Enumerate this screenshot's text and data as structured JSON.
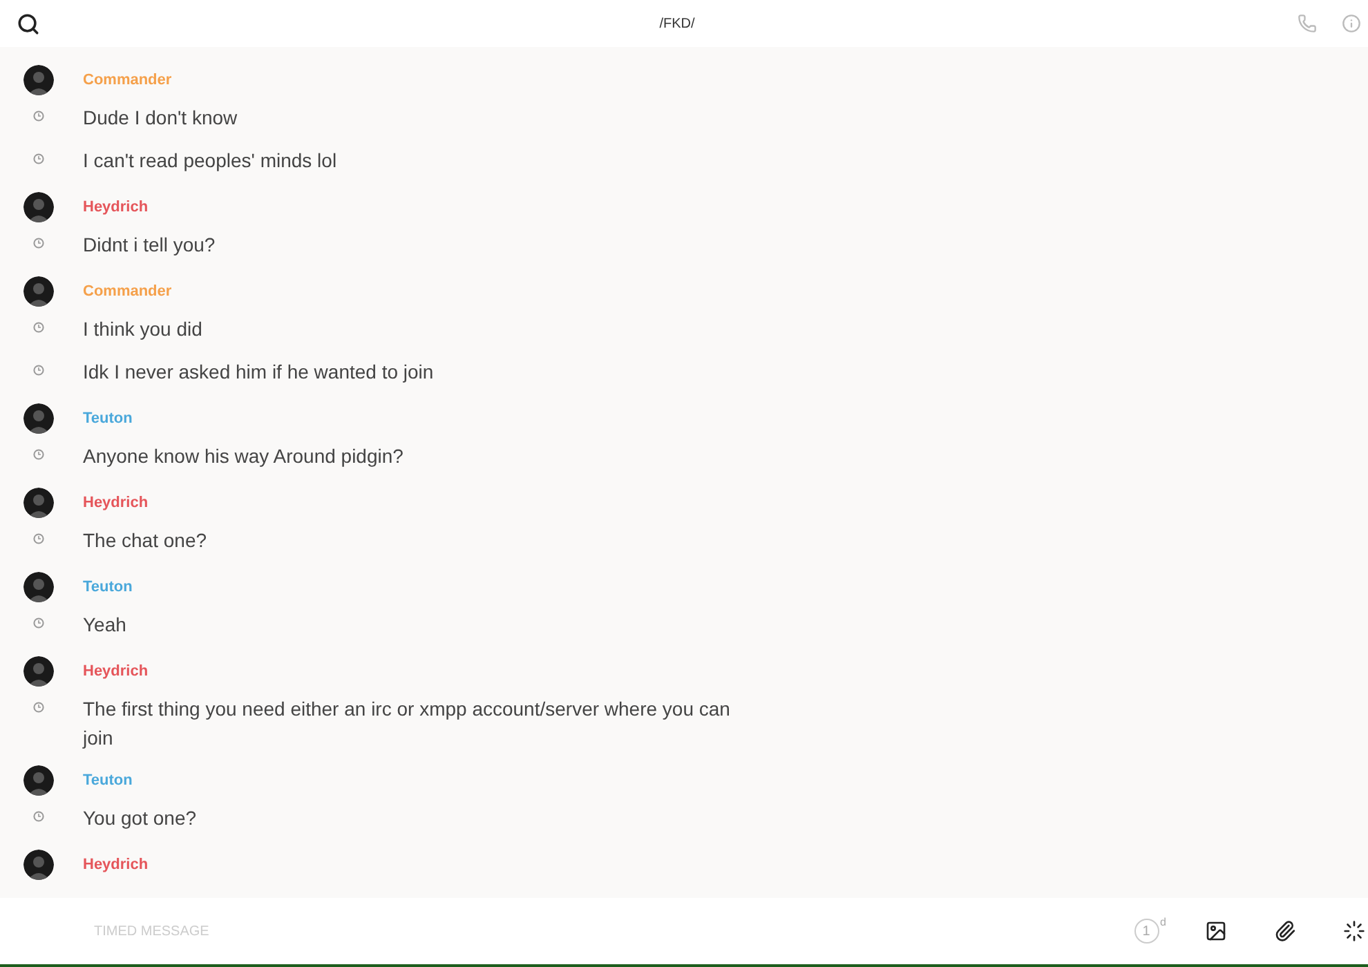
{
  "header": {
    "title": "/FKD/"
  },
  "groups": [
    {
      "sender": "Commander",
      "color": "#f5a04a",
      "messages": [
        "Dude I don't know",
        "I can't read peoples' minds lol"
      ]
    },
    {
      "sender": "Heydrich",
      "color": "#e5555a",
      "messages": [
        "Didnt i tell you?"
      ]
    },
    {
      "sender": "Commander",
      "color": "#f5a04a",
      "messages": [
        "I think you did",
        "Idk I never asked him if he wanted to join"
      ]
    },
    {
      "sender": "Teuton",
      "color": "#4aa8db",
      "messages": [
        "Anyone know his way Around pidgin?"
      ]
    },
    {
      "sender": "Heydrich",
      "color": "#e5555a",
      "messages": [
        "The chat one?"
      ]
    },
    {
      "sender": "Teuton",
      "color": "#4aa8db",
      "messages": [
        "Yeah"
      ]
    },
    {
      "sender": "Heydrich",
      "color": "#e5555a",
      "messages": [
        "The first thing you need either an irc or xmpp account/server where you can join"
      ]
    },
    {
      "sender": "Teuton",
      "color": "#4aa8db",
      "messages": [
        "You got one?"
      ]
    },
    {
      "sender": "Heydrich",
      "color": "#e5555a"
    }
  ],
  "composer": {
    "placeholder": "TIMED MESSAGE",
    "timer_value": "1",
    "timer_unit": "d"
  }
}
